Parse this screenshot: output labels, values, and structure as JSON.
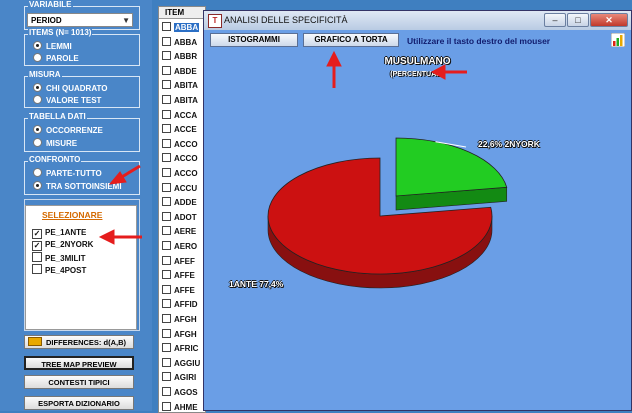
{
  "left": {
    "variabile": {
      "title": "VARIABILE",
      "value": "PERIOD"
    },
    "items": {
      "title": "ITEMS (N= 1013)",
      "options": [
        {
          "label": "LEMMI",
          "on": true
        },
        {
          "label": "PAROLE",
          "on": false
        }
      ]
    },
    "misura": {
      "title": "MISURA",
      "options": [
        {
          "label": "CHI QUADRATO",
          "on": true
        },
        {
          "label": "VALORE TEST",
          "on": false
        }
      ]
    },
    "tabella": {
      "title": "TABELLA DATI",
      "options": [
        {
          "label": "OCCORRENZE",
          "on": true
        },
        {
          "label": "MISURE",
          "on": false
        }
      ]
    },
    "confronto": {
      "title": "CONFRONTO",
      "options": [
        {
          "label": "PARTE-TUTTO",
          "on": false
        },
        {
          "label": "TRA SOTTOINSIEMI",
          "on": true
        }
      ]
    },
    "selezionare": {
      "label": "SELEZIONARE",
      "items": [
        {
          "label": "PE_1ANTE",
          "checked": true
        },
        {
          "label": "PE_2NYORK",
          "checked": true
        },
        {
          "label": "PE_3MILIT",
          "checked": false
        },
        {
          "label": "PE_4POST",
          "checked": false
        }
      ]
    },
    "buttons": {
      "differences": "DIFFERENCES: d(A,B)",
      "treemap": "TREE MAP PREVIEW",
      "contesti": "CONTESTI TIPICI",
      "esporta": "ESPORTA DIZIONARIO"
    }
  },
  "list": {
    "header": "ITEM",
    "rows": [
      "ABBA",
      "ABBA",
      "ABBR",
      "ABDE",
      "ABITA",
      "ABITA",
      "ACCA",
      "ACCE",
      "ACCO",
      "ACCO",
      "ACCO",
      "ACCU",
      "ADDE",
      "ADOT",
      "AERE",
      "AERO",
      "AFEF",
      "AFFE",
      "AFFE",
      "AFFID",
      "AFGH",
      "AFGH",
      "AFRIC",
      "AGGIU",
      "AGIRI",
      "AGOS",
      "AHME"
    ]
  },
  "dialog": {
    "title": "ANALISI DELLE SPECIFICITÀ",
    "btn_istogrammi": "ISTOGRAMMI",
    "btn_torta": "GRAFICO A TORTA",
    "hint": "Utilizzare il tasto destro del mouser"
  },
  "chart_data": {
    "type": "pie",
    "title": "MUSULMANO",
    "subtitle": "(PERCENTUALI)",
    "slices": [
      {
        "name": "1ANTE",
        "value": 77.4,
        "label": "1ANTE  77,4%",
        "color": "#cc1111"
      },
      {
        "name": "2NYORK",
        "value": 22.6,
        "label": "22,6%  2NYORK",
        "color": "#22cc22"
      }
    ]
  }
}
